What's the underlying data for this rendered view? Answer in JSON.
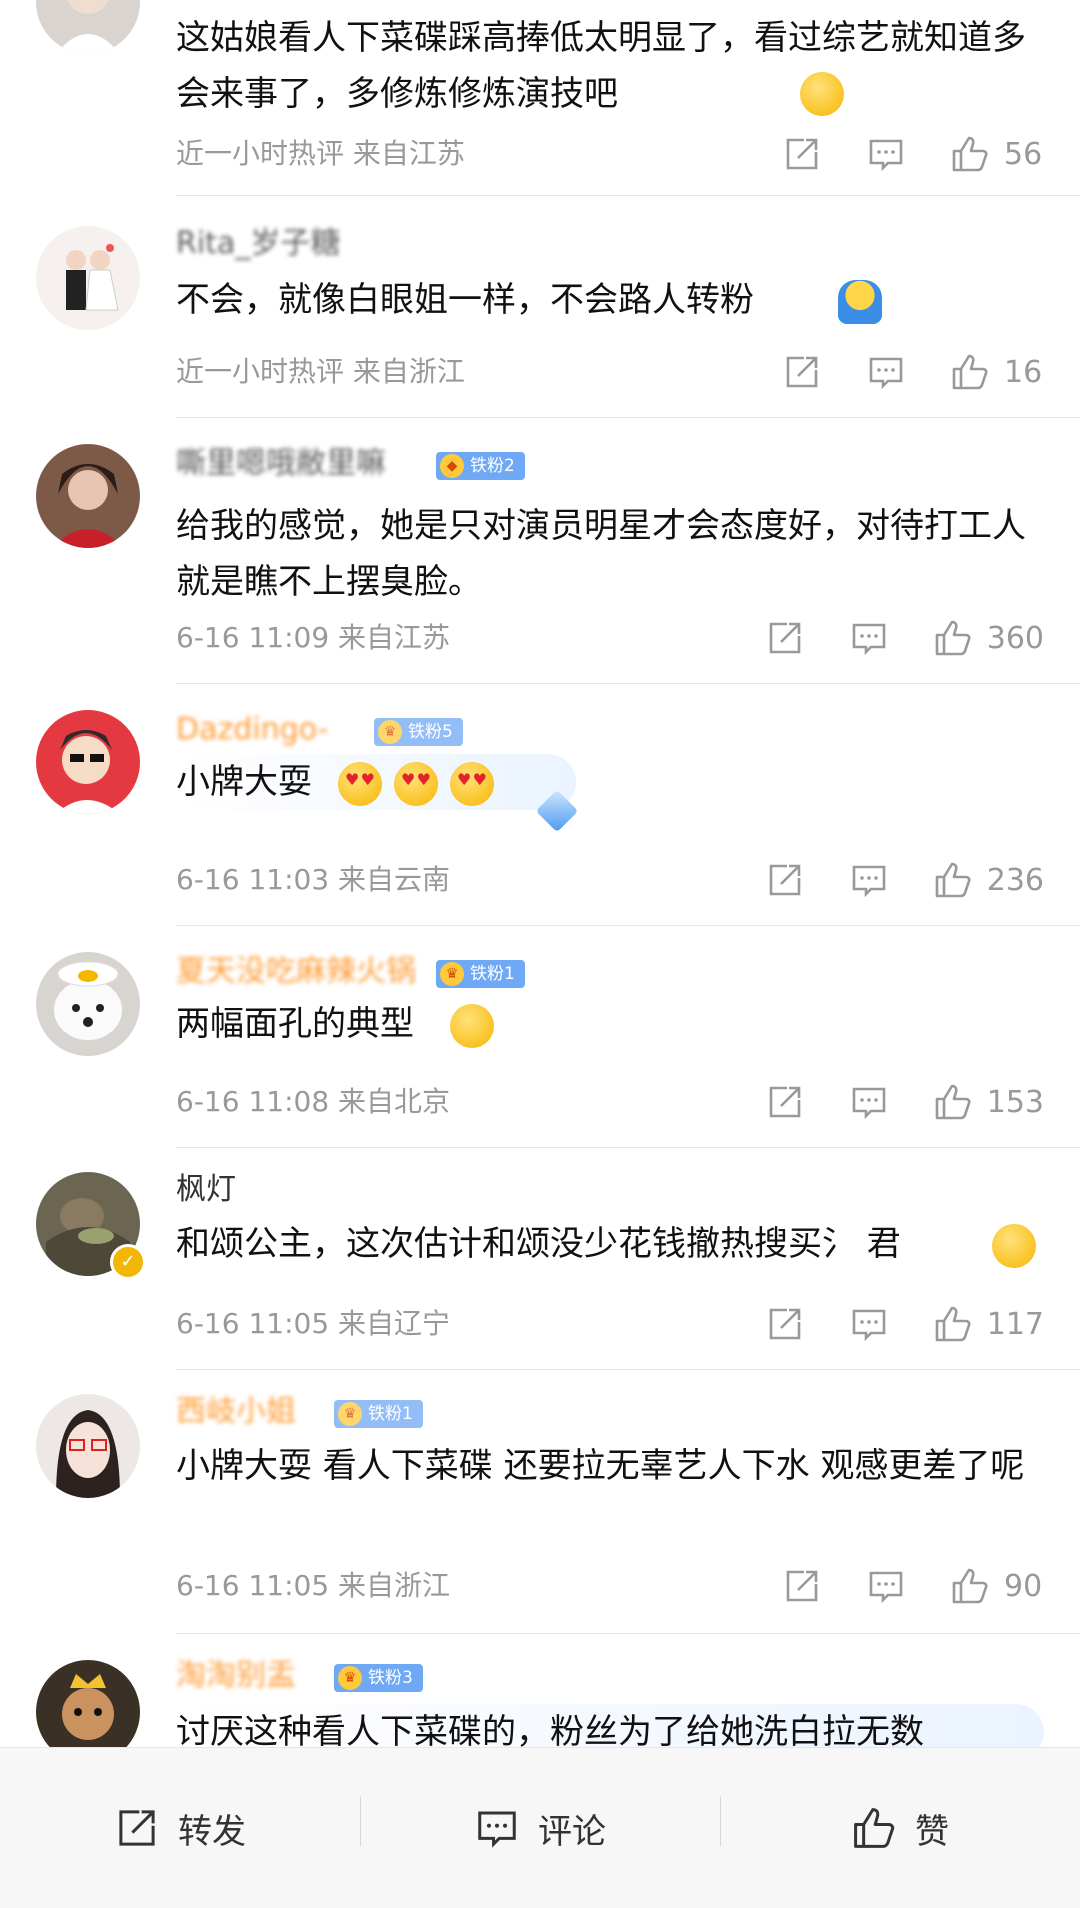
{
  "comments": [
    {
      "name": "",
      "text": "这姑娘看人下菜碟踩高捧低太明显了，看过综艺就知道多会来事了，多修炼修炼演技吧",
      "meta": "近一小时热评 来自江苏",
      "likes": "56"
    },
    {
      "name": "Rita_岁子糖",
      "text": "不会，就像白眼姐一样，不会路人转粉",
      "meta": "近一小时热评 来自浙江",
      "likes": "16"
    },
    {
      "name": "嘶里嗯哦敝里嘛",
      "badge": "铁粉2",
      "text": "给我的感觉，她是只对演员明星才会态度好，对待打工人就是瞧不上摆臭脸。",
      "meta": "6-16 11:09 来自江苏",
      "likes": "360"
    },
    {
      "name": "Dazdingo-",
      "badge": "铁粉5",
      "text": "小牌大耍",
      "meta": "6-16 11:03 来自云南",
      "likes": "236"
    },
    {
      "name": "夏天没吃麻辣火锅",
      "badge": "铁粉1",
      "text": "两幅面孔的典型",
      "meta": "6-16 11:08 来自北京",
      "likes": "153"
    },
    {
      "name": "枫灯",
      "text": "和颂公主，这次估计和颂没少花钱撤热搜买氵 君",
      "meta": "6-16 11:05 来自辽宁",
      "likes": "117"
    },
    {
      "name": "西岐小姐",
      "badge": "铁粉1",
      "text": "小牌大耍 看人下菜碟 还要拉无辜艺人下水 观感更差了呢",
      "meta": "6-16 11:05 来自浙江",
      "likes": "90"
    },
    {
      "name": "淘淘别盂",
      "badge": "铁粉3",
      "text": "讨厌这种看人下菜碟的，粉丝为了给她洗白拉无数",
      "meta": "",
      "likes": ""
    }
  ],
  "bottom_bar": {
    "repost": "转发",
    "comment": "评论",
    "like": "赞"
  },
  "colors": {
    "orange_name": "#ff8200",
    "fan_badge": "#6fa8f5",
    "meta_gray": "#999999"
  }
}
